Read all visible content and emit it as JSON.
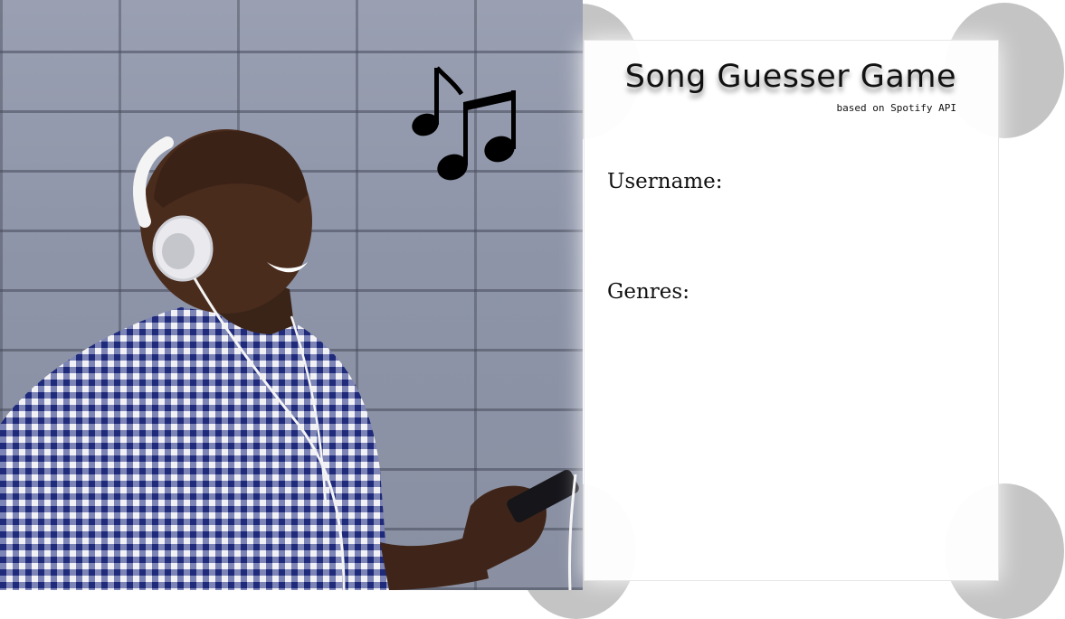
{
  "form": {
    "title": "Song Guesser Game",
    "subtitle": "based on Spotify API",
    "username_label": "Username:",
    "genres_label": "Genres:"
  },
  "icons": {
    "music": "music-notes-icon"
  },
  "colors": {
    "circle": "#c4c4c4",
    "card_background": "#ffffff",
    "text": "#111111",
    "brick_wall": "#8d94a8"
  }
}
